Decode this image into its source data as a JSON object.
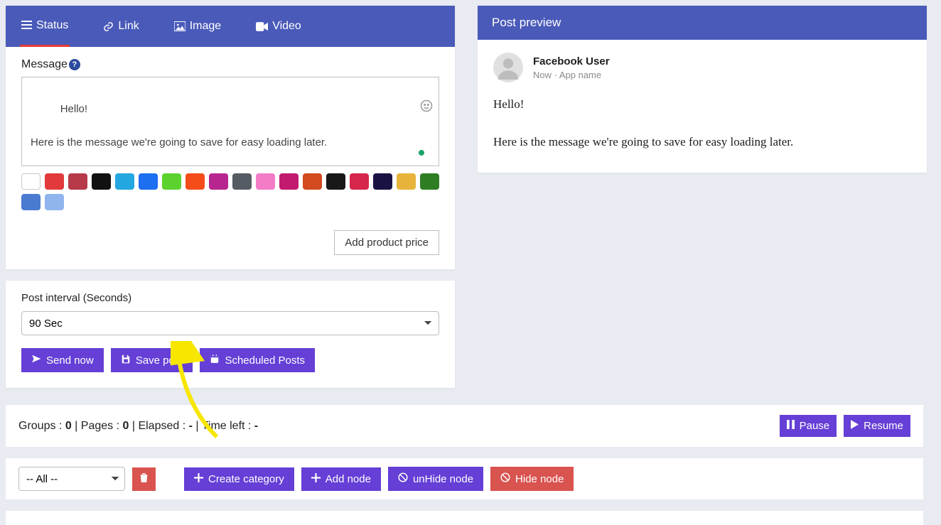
{
  "tabs": {
    "status": "Status",
    "link": "Link",
    "image": "Image",
    "video": "Video"
  },
  "composer": {
    "message_label": "Message",
    "message_text": "Hello!\n\nHere is the message we're going to save for easy loading later.",
    "add_price": "Add product price"
  },
  "swatches": [
    "#ffffff",
    "#e23a3c",
    "#b63a48",
    "#111111",
    "#22a7e0",
    "#1d6ef0",
    "#5bd22e",
    "#f44d19",
    "#b7268f",
    "#555c63",
    "#f27cc6",
    "#c21a6f",
    "#d24a1d",
    "#181818",
    "#d6264c",
    "#1b1244",
    "#e7b33a",
    "#2f7d23",
    "#4a7bd0",
    "#8fb4ee"
  ],
  "interval": {
    "label": "Post interval (Seconds)",
    "value": "90 Sec",
    "send_now": "Send now",
    "save_post": "Save post",
    "scheduled": "Scheduled Posts"
  },
  "statusbar": {
    "groups_label": "Groups : ",
    "groups_val": "0",
    "pages_label": "Pages : ",
    "pages_val": "0",
    "elapsed_label": "Elapsed : ",
    "elapsed_val": "-",
    "timeleft_label": "Time left : ",
    "timeleft_val": "-",
    "pause": "Pause",
    "resume": "Resume"
  },
  "nodes": {
    "filter": "-- All --",
    "create_cat": "Create category",
    "add_node": "Add node",
    "unhide": "unHide node",
    "hide": "Hide node"
  },
  "preview": {
    "title": "Post preview",
    "user": "Facebook User",
    "meta": "Now · App name",
    "body": "Hello!\n\nHere is the message we're going to save for easy loading later."
  }
}
